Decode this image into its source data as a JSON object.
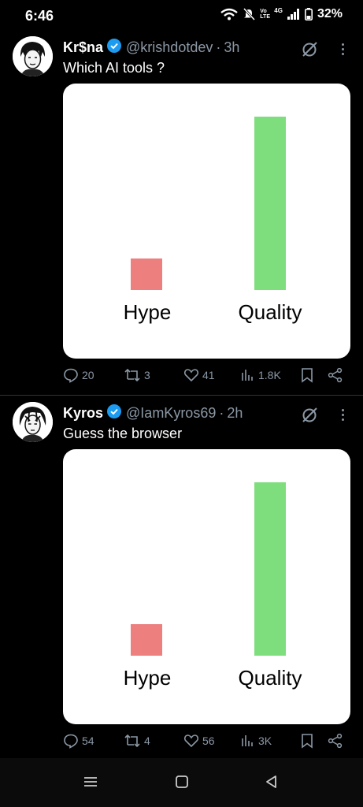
{
  "status_bar": {
    "time": "6:46",
    "network_label": "Vo LTE",
    "signal_label": "4G",
    "battery": "32%"
  },
  "tweets": [
    {
      "author_name": "Kr$na",
      "handle": "@krishdotdev",
      "time_ago": "3h",
      "text": "Which AI tools ?",
      "chart_data": {
        "type": "bar",
        "categories": [
          "Hype",
          "Quality"
        ],
        "values": [
          18,
          100
        ],
        "colors": [
          "#ee7f7f",
          "#7ede7e"
        ],
        "ylim": [
          0,
          100
        ]
      },
      "replies": "20",
      "reposts": "3",
      "likes": "41",
      "views": "1.8K"
    },
    {
      "author_name": "Kyros",
      "handle": "@IamKyros69",
      "time_ago": "2h",
      "text": "Guess the browser",
      "chart_data": {
        "type": "bar",
        "categories": [
          "Hype",
          "Quality"
        ],
        "values": [
          18,
          100
        ],
        "colors": [
          "#ee7f7f",
          "#7ede7e"
        ],
        "ylim": [
          0,
          100
        ]
      },
      "replies": "54",
      "reposts": "4",
      "likes": "56",
      "views": "3K"
    }
  ],
  "colors": {
    "background": "#000000",
    "verified": "#1d9bf0",
    "muted": "#8b98a5"
  }
}
